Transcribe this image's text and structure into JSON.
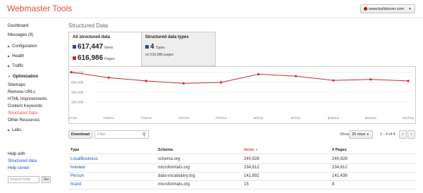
{
  "header": {
    "app_title": "Webmaster Tools",
    "site": "www.buildzoom.com"
  },
  "sidebar": {
    "items": [
      {
        "label": "Dashboard"
      },
      {
        "label": "Messages (9)"
      },
      {
        "label": "Configuration"
      },
      {
        "label": "Health"
      },
      {
        "label": "Traffic"
      },
      {
        "label": "Optimization"
      },
      {
        "label": "Sitemaps"
      },
      {
        "label": "Remove URLs"
      },
      {
        "label": "HTML Improvements"
      },
      {
        "label": "Content Keywords"
      },
      {
        "label": "Structured Data"
      },
      {
        "label": "Other Resources"
      },
      {
        "label": "Labs"
      }
    ],
    "help": {
      "label": "Help with",
      "link1": "Structured data",
      "link2": "Help center",
      "search_placeholder": "Search help",
      "go": "Go"
    }
  },
  "main": {
    "page_title": "Structured Data",
    "tabs": [
      {
        "title": "All structured data",
        "stats": [
          {
            "value": "617,447",
            "unit": "Items",
            "color": "#2a3fc2"
          },
          {
            "value": "616,986",
            "unit": "Pages",
            "color": "#cc2b2b"
          }
        ]
      },
      {
        "title": "Structured data types",
        "stat": {
          "value": "4",
          "unit": "Types",
          "color": "#2a3fc2"
        },
        "sub": "on 616,986 pages"
      }
    ]
  },
  "chart_data": {
    "type": "line",
    "x": [
      "7/17/12",
      "7/20/12",
      "7/24/12",
      "7/27/12",
      "7/31/12",
      "8/3/12",
      "8/7/12",
      "8/10/12",
      "8/14/12",
      "8/17/12"
    ],
    "series": [
      {
        "values": [
          800000,
          690000,
          625000,
          575000,
          595000,
          760000,
          720000,
          635000,
          655000,
          625000
        ],
        "color": "#cc2b2b"
      }
    ],
    "yticks": [
      "800,000",
      "600,000",
      "400,000",
      "200,000"
    ],
    "ylim": [
      0,
      850000
    ],
    "grid": true
  },
  "table": {
    "download": "Download",
    "filter_placeholder": "Filter",
    "show_label": "Show",
    "rows_option": "25 rows",
    "range": "1 - 4 of 4",
    "columns": [
      "Type",
      "Schema",
      "Items",
      "# Pages"
    ],
    "rows": [
      [
        "LocalBusiness",
        "schema.org",
        "240,928",
        "240,928"
      ],
      [
        "hreview",
        "microformats.org",
        "234,612",
        "234,612"
      ],
      [
        "Person",
        "data-vocabulary.org",
        "141,892",
        "141,438"
      ],
      [
        "hcard",
        "microformats.org",
        "15",
        "8"
      ]
    ]
  }
}
